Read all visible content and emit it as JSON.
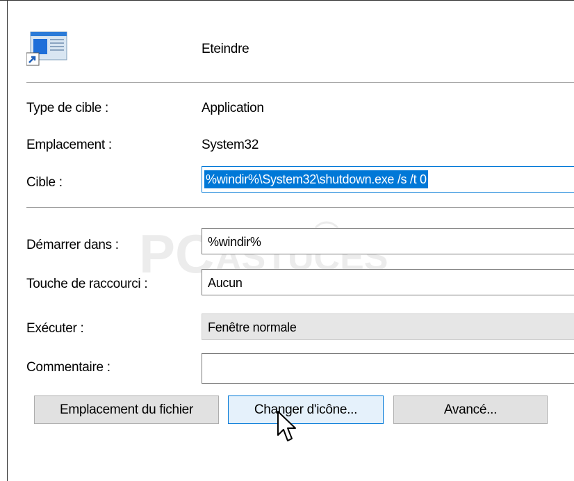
{
  "header": {
    "title": "Eteindre",
    "icon": "shortcut-app-icon"
  },
  "info": {
    "type_label": "Type de cible :",
    "type_value": "Application",
    "location_label": "Emplacement :",
    "location_value": "System32",
    "target_label": "Cible :",
    "target_value": "%windir%\\System32\\shutdown.exe /s /t 0"
  },
  "fields": {
    "start_in_label": "Démarrer dans :",
    "start_in_value": "%windir%",
    "shortcut_key_label": "Touche de raccourci :",
    "shortcut_key_value": "Aucun",
    "run_label": "Exécuter :",
    "run_value": "Fenêtre normale",
    "comment_label": "Commentaire :",
    "comment_value": ""
  },
  "buttons": {
    "open_location": "Emplacement du fichier",
    "change_icon": "Changer d'icône...",
    "advanced": "Avancé..."
  },
  "watermark": {
    "text": "PC ASTUCES"
  },
  "colors": {
    "accent": "#0078d7",
    "button_bg": "#e1e1e1",
    "gray_field": "#e6e6e6"
  }
}
